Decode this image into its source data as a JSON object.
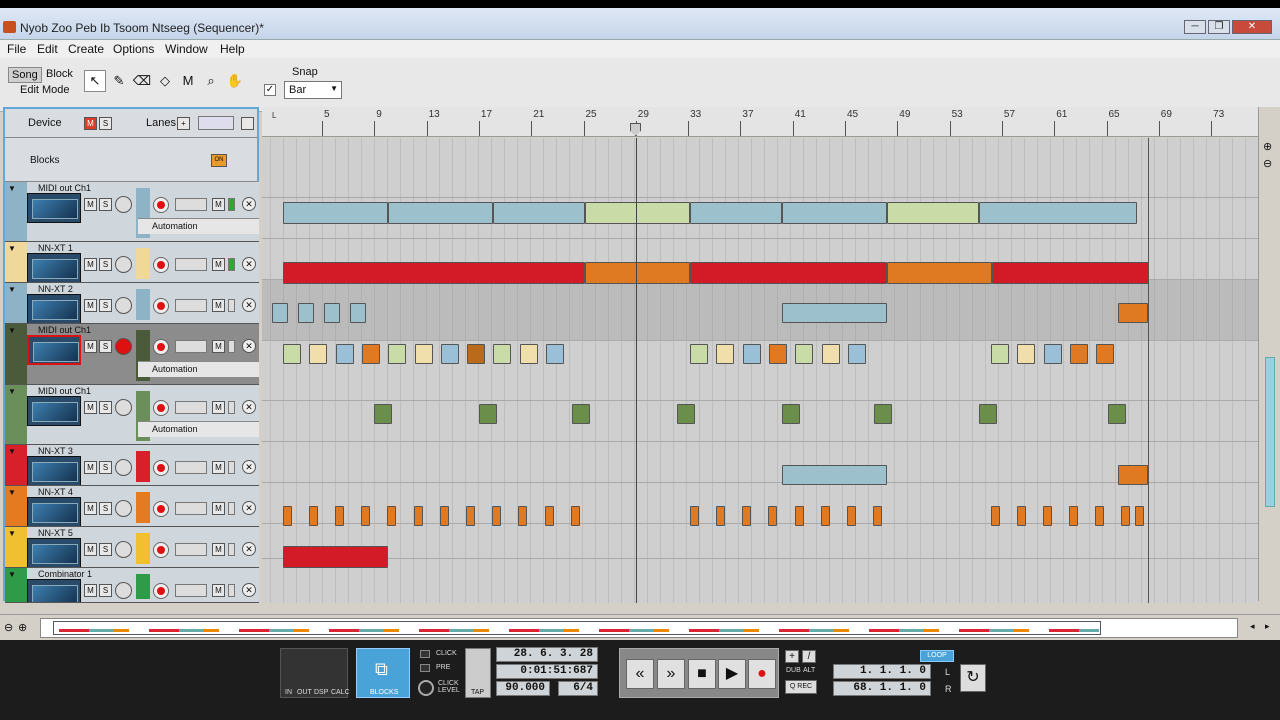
{
  "window": {
    "title": "Nyob Zoo Peb Ib Tsoom Ntseeg (Sequencer)*",
    "min": "─",
    "max": "❐",
    "close": "✕"
  },
  "menu": [
    "File",
    "Edit",
    "Create",
    "Options",
    "Window",
    "Help"
  ],
  "toolbar": {
    "mode_song": "Song",
    "mode_block": "Block",
    "edit_mode": "Edit Mode",
    "snap_label": "Snap",
    "snap_value": "Bar",
    "snap_check": "✓"
  },
  "header": {
    "device": "Device",
    "mute": "M",
    "solo": "S",
    "lanes": "Lanes",
    "plus": "+",
    "blocks": "Blocks",
    "blocks_toggle": "ON"
  },
  "ruler": {
    "ticks": [
      "5",
      "9",
      "13",
      "17",
      "21",
      "25",
      "29",
      "33",
      "37",
      "41",
      "45",
      "49",
      "53",
      "57",
      "61",
      "65",
      "69",
      "73"
    ]
  },
  "tracks": [
    {
      "name": "MIDI out Ch1",
      "color": "#8fb3c6",
      "automation": "Automation"
    },
    {
      "name": "NN-XT 1",
      "color": "#f0d89a"
    },
    {
      "name": "NN-XT 2",
      "color": "#8fb3c6"
    },
    {
      "name": "MIDI out Ch1",
      "color": "#4a5a3a",
      "automation": "Automation"
    },
    {
      "name": "MIDI out Ch1",
      "color": "#6b8f5a",
      "automation": "Automation"
    },
    {
      "name": "NN-XT 3",
      "color": "#d8202a"
    },
    {
      "name": "NN-XT 4",
      "color": "#e57b20"
    },
    {
      "name": "NN-XT 5",
      "color": "#f0c030"
    },
    {
      "name": "Combinator 1",
      "color": "#2f9a48"
    }
  ],
  "transport": {
    "in": "IN",
    "out": "OUT",
    "dsp": "DSP",
    "calc": "CALC",
    "blocks": "BLOCKS",
    "click": "CLICK",
    "pre": "PRE",
    "click_level": "CLICK LEVEL",
    "tap": "TAP",
    "position": "28. 6. 3. 28",
    "time": "0:01:51:687",
    "tempo": "90.000",
    "signature": "6/4",
    "rewind": "«",
    "forward": "»",
    "stop": "■",
    "play": "▶",
    "dub": "DUB",
    "alt": "ALT",
    "qrec": "Q REC",
    "loop": "LOOP",
    "left_locator": "1. 1. 1. 0",
    "right_locator": "68. 1. 1. 0",
    "l": "L",
    "r": "R"
  }
}
